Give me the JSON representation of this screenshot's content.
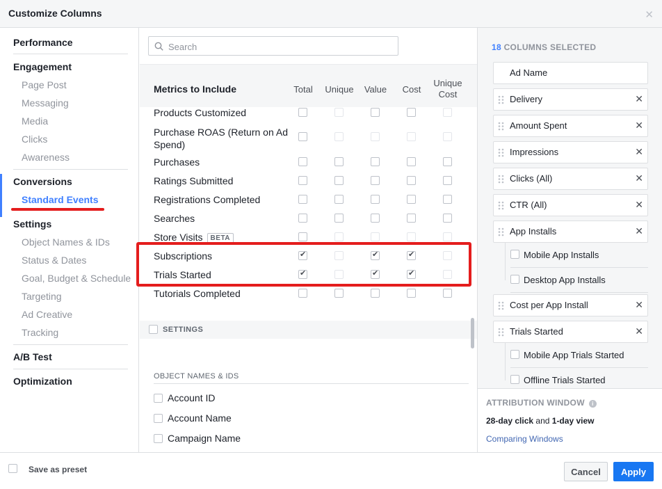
{
  "dialog": {
    "title": "Customize Columns",
    "close_icon": "close-icon"
  },
  "sidebar": {
    "sections": [
      {
        "label": "Performance"
      },
      {
        "label": "Engagement",
        "items": [
          "Page Post",
          "Messaging",
          "Media",
          "Clicks",
          "Awareness"
        ]
      },
      {
        "label": "Conversions",
        "items": [
          "Standard Events"
        ],
        "active_item": "Standard Events"
      },
      {
        "label": "Settings",
        "items": [
          "Object Names & IDs",
          "Status & Dates",
          "Goal, Budget & Schedule",
          "Targeting",
          "Ad Creative",
          "Tracking"
        ]
      },
      {
        "label": "A/B Test"
      },
      {
        "label": "Optimization"
      }
    ]
  },
  "main": {
    "search_placeholder": "Search",
    "metrics_title": "Metrics to Include",
    "columns": [
      "Total",
      "Unique",
      "Value",
      "Cost",
      "Unique Cost"
    ],
    "rows": [
      {
        "label": "Products Customized",
        "checked": [
          false,
          false,
          false,
          false,
          false
        ],
        "enabled": [
          true,
          false,
          true,
          true,
          false
        ]
      },
      {
        "label": "Purchase ROAS (Return on Ad Spend)",
        "checked": [
          false,
          false,
          false,
          false,
          false
        ],
        "enabled": [
          true,
          false,
          false,
          false,
          false
        ]
      },
      {
        "label": "Purchases",
        "checked": [
          false,
          false,
          false,
          false,
          false
        ],
        "enabled": [
          true,
          true,
          true,
          true,
          true
        ]
      },
      {
        "label": "Ratings Submitted",
        "checked": [
          false,
          false,
          false,
          false,
          false
        ],
        "enabled": [
          true,
          true,
          true,
          true,
          true
        ]
      },
      {
        "label": "Registrations Completed",
        "checked": [
          false,
          false,
          false,
          false,
          false
        ],
        "enabled": [
          true,
          true,
          true,
          true,
          true
        ]
      },
      {
        "label": "Searches",
        "checked": [
          false,
          false,
          false,
          false,
          false
        ],
        "enabled": [
          true,
          true,
          true,
          true,
          true
        ]
      },
      {
        "label": "Store Visits",
        "badge": "BETA",
        "checked": [
          false,
          false,
          false,
          false,
          false
        ],
        "enabled": [
          true,
          false,
          false,
          false,
          false
        ]
      },
      {
        "label": "Subscriptions",
        "checked": [
          true,
          false,
          true,
          true,
          false
        ],
        "enabled": [
          true,
          false,
          true,
          true,
          false
        ]
      },
      {
        "label": "Trials Started",
        "checked": [
          true,
          false,
          true,
          true,
          false
        ],
        "enabled": [
          true,
          false,
          true,
          true,
          false
        ]
      },
      {
        "label": "Tutorials Completed",
        "checked": [
          false,
          false,
          false,
          false,
          false
        ],
        "enabled": [
          true,
          true,
          true,
          true,
          true
        ]
      }
    ],
    "settings_label": "SETTINGS",
    "object_section_label": "OBJECT NAMES & IDS",
    "object_items": [
      "Account ID",
      "Account Name",
      "Campaign Name"
    ]
  },
  "selected": {
    "count": "18",
    "count_label": "COLUMNS SELECTED",
    "items": [
      {
        "label": "Ad Name",
        "removable": false
      },
      {
        "label": "Delivery",
        "removable": true
      },
      {
        "label": "Amount Spent",
        "removable": true
      },
      {
        "label": "Impressions",
        "removable": true
      },
      {
        "label": "Clicks (All)",
        "removable": true
      },
      {
        "label": "CTR (All)",
        "removable": true
      },
      {
        "label": "App Installs",
        "removable": true,
        "subitems": [
          "Mobile App Installs",
          "Desktop App Installs"
        ]
      },
      {
        "label": "Cost per App Install",
        "removable": true
      },
      {
        "label": "Trials Started",
        "removable": true,
        "subitems": [
          "Mobile App Trials Started",
          "Offline Trials Started"
        ]
      }
    ]
  },
  "attribution": {
    "title": "ATTRIBUTION WINDOW",
    "click_window": "28-day click",
    "and": "and",
    "view_window": "1-day view",
    "link": "Comparing Windows"
  },
  "footer": {
    "preset_label": "Save as preset",
    "cancel_label": "Cancel",
    "apply_label": "Apply"
  },
  "colors": {
    "accent": "#4080ff",
    "apply": "#1877f2",
    "highlight": "#e41d1d"
  }
}
